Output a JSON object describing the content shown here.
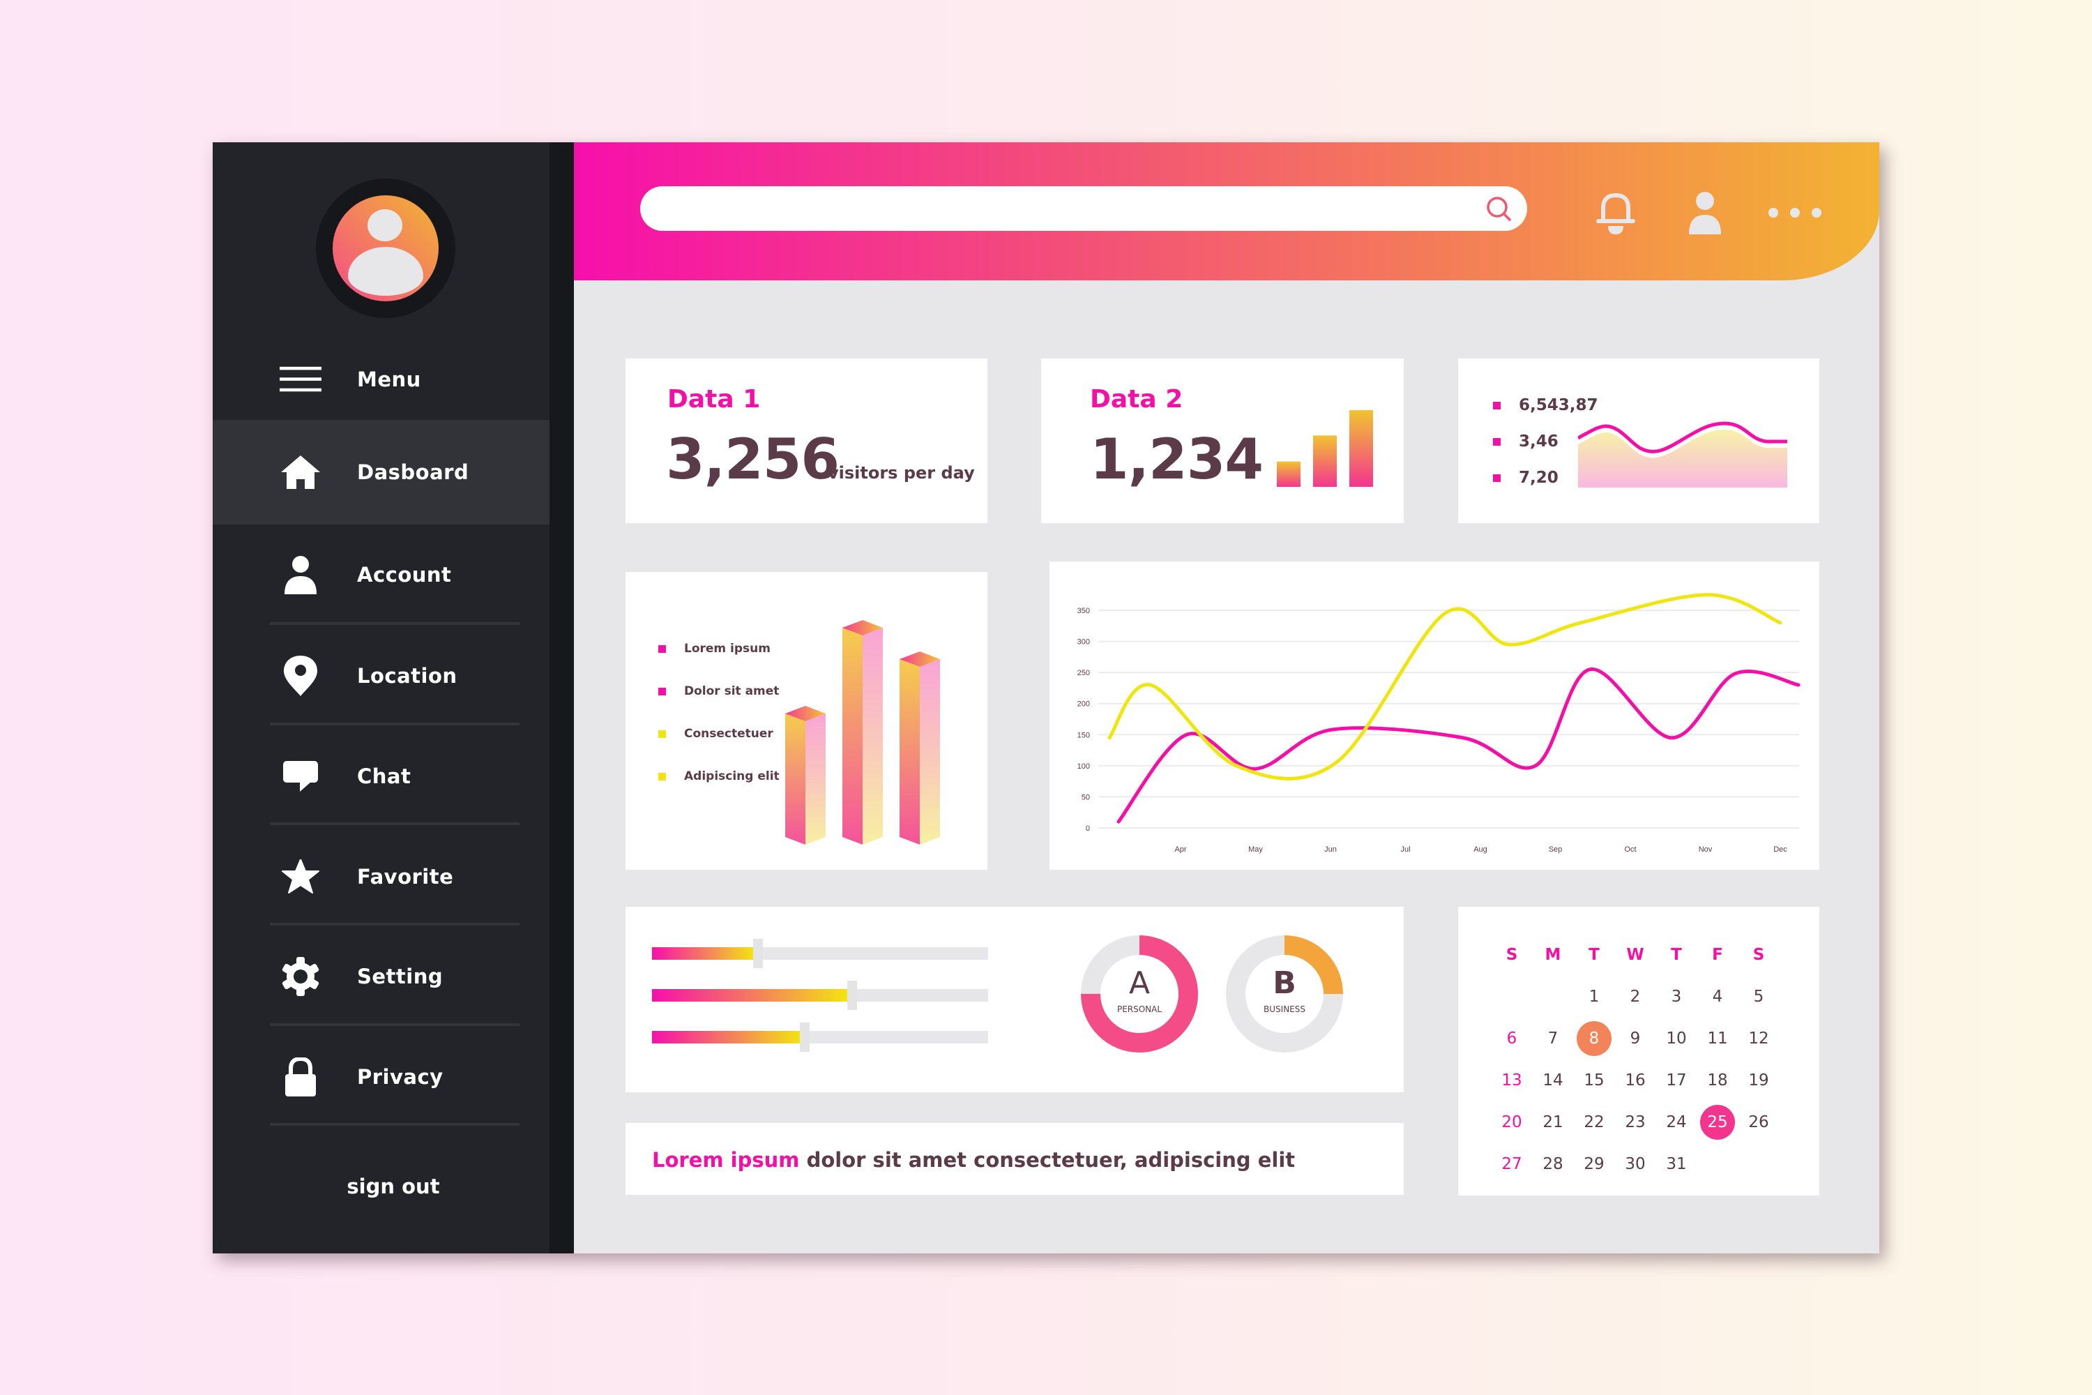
{
  "sidebar": {
    "menu_label": "Menu",
    "items": [
      {
        "label": "Dasboard",
        "icon": "home-icon",
        "active": true
      },
      {
        "label": "Account",
        "icon": "user-icon"
      },
      {
        "label": "Location",
        "icon": "location-pin-icon"
      },
      {
        "label": "Chat",
        "icon": "chat-bubble-icon"
      },
      {
        "label": "Favorite",
        "icon": "star-icon"
      },
      {
        "label": "Setting",
        "icon": "gear-icon"
      },
      {
        "label": "Privacy",
        "icon": "lock-icon"
      }
    ],
    "signout_label": "sign out"
  },
  "header": {
    "search_value": "",
    "search_placeholder": "",
    "icons": [
      "search-icon",
      "bell-icon",
      "user-icon",
      "more-dots-icon"
    ]
  },
  "cards": {
    "data1": {
      "title": "Data 1",
      "value": "3,256",
      "unit": "visitors per day"
    },
    "data2": {
      "title": "Data 2",
      "value": "1,234",
      "mini_bars": [
        0.33,
        0.67,
        1.0
      ]
    },
    "stats": {
      "values": [
        "6,543,87",
        "3,46",
        "7,20"
      ]
    }
  },
  "bar_legend": [
    {
      "label": "Lorem ipsum",
      "color": "#f40fa6"
    },
    {
      "label": "Dolor sit amet",
      "color": "#f40fa6"
    },
    {
      "label": "Consectetuer",
      "color": "#f0e60f"
    },
    {
      "label": "Adipiscing elit",
      "color": "#f0e60f"
    }
  ],
  "bar3d": {
    "values": [
      0.59,
      1.0,
      0.85
    ]
  },
  "sliders": [
    0.3,
    0.58,
    0.44
  ],
  "donuts": [
    {
      "letter": "A",
      "label": "PERSONAL",
      "fraction": 0.75,
      "color": "#f34c86"
    },
    {
      "letter": "B",
      "label": "BUSINESS",
      "fraction": 0.25,
      "color": "#f3a53c"
    }
  ],
  "bottom_text": {
    "accent": "Lorem ipsum",
    "rest": " dolor sit amet consectetuer, adipiscing elit"
  },
  "calendar": {
    "weekdays": [
      "S",
      "M",
      "T",
      "W",
      "T",
      "F",
      "S"
    ],
    "start_offset": 2,
    "days_in_month": 31,
    "highlighted": [
      {
        "day": 8,
        "color": "#f3845a"
      },
      {
        "day": 25,
        "color": "#f3358f"
      }
    ]
  },
  "colors": {
    "accent": "#f40fa6",
    "secondary": "#f0e60f",
    "text": "#5b3b48",
    "sidebar": "#232429"
  },
  "chart_data": {
    "type": "line",
    "title": "",
    "xlabel": "",
    "ylabel": "",
    "categories": [
      "Apr",
      "May",
      "Jun",
      "Jul",
      "Aug",
      "Sep",
      "Oct",
      "Nov",
      "Dec"
    ],
    "yticks": [
      0,
      50,
      100,
      150,
      200,
      250,
      300,
      350
    ],
    "ylim": [
      0,
      350
    ],
    "grid": true,
    "legend": "none",
    "series": [
      {
        "name": "pink",
        "color": "#f40fa6",
        "x": [
          0.1,
          0.5,
          1.0,
          1.45,
          2.6,
          3.35,
          4.2,
          5.7,
          6.6,
          7.7,
          8.6,
          9.0
        ],
        "values": [
          10,
          150,
          95,
          158,
          145,
          100,
          255,
          145,
          248,
          230
        ]
      },
      {
        "name": "yellow",
        "color": "#f0e60f",
        "x": [
          0,
          0.35,
          1.5,
          2.0,
          2.8,
          3.55,
          4.4,
          6.0,
          7.2,
          8.4,
          9.0
        ],
        "values": [
          145,
          230,
          100,
          105,
          345,
          295,
          330,
          375,
          330
        ]
      }
    ]
  }
}
